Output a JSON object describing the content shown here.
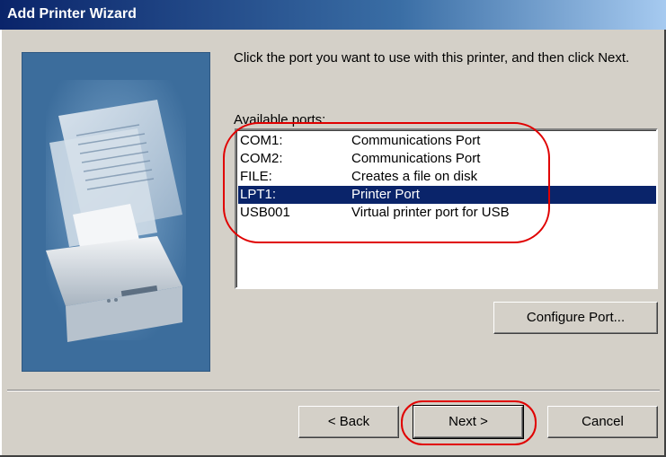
{
  "window": {
    "title": "Add Printer Wizard"
  },
  "instruction": "Click the port you want to use with this printer, and then click Next.",
  "ports": {
    "label": "Available ports:",
    "rows": [
      {
        "port": "COM1:",
        "description": "Communications Port",
        "selected": false
      },
      {
        "port": "COM2:",
        "description": "Communications Port",
        "selected": false
      },
      {
        "port": "FILE:",
        "description": "Creates a file on disk",
        "selected": false
      },
      {
        "port": "LPT1:",
        "description": "Printer Port",
        "selected": true
      },
      {
        "port": "USB001",
        "description": "Virtual printer port for USB",
        "selected": false
      }
    ]
  },
  "buttons": {
    "configure": "Configure Port...",
    "back": "< Back",
    "next": "Next >",
    "cancel": "Cancel"
  },
  "colors": {
    "title_bar": "#0a246a",
    "selection": "#0a246a",
    "annotation": "#e00000",
    "art_background": "#3c6d9c"
  }
}
